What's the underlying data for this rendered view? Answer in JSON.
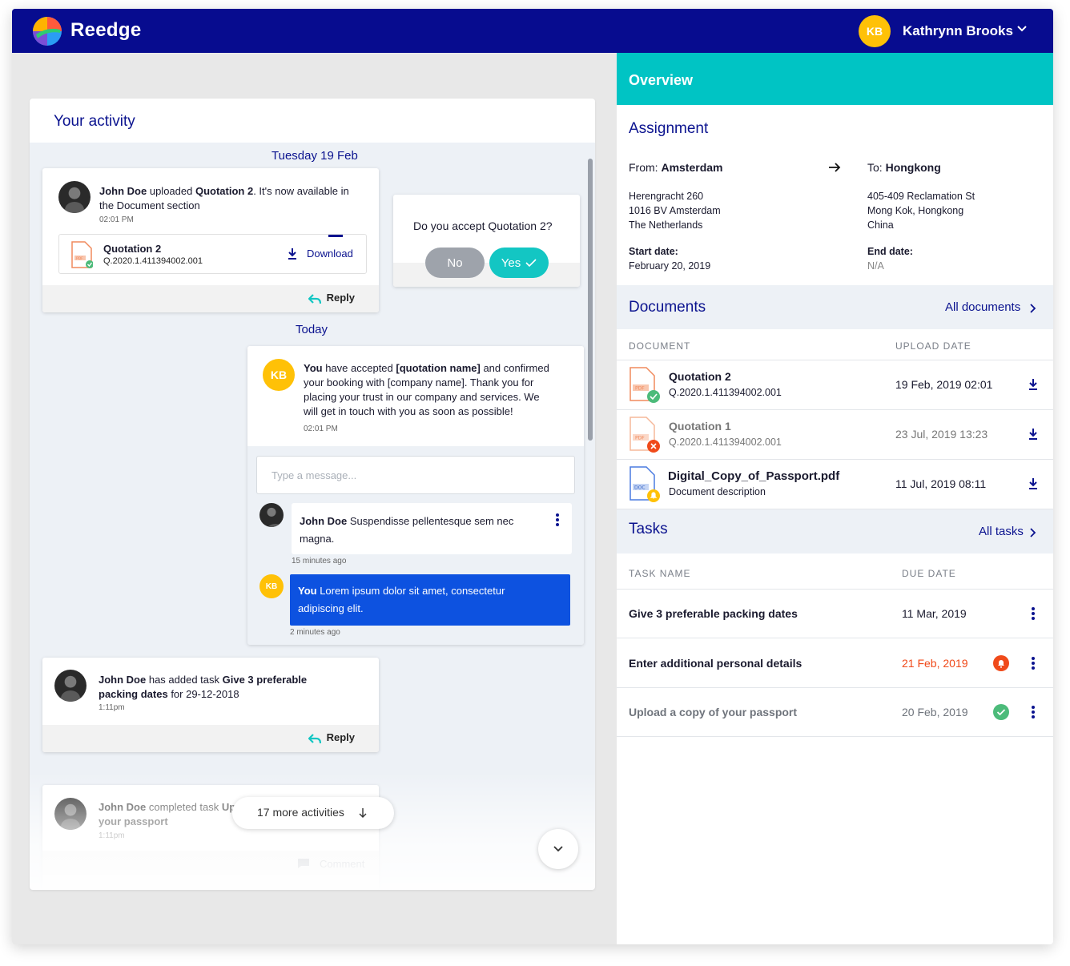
{
  "app": {
    "brand": "Reedge",
    "user_initials": "KB",
    "user_name": "Kathrynn Brooks"
  },
  "activity": {
    "title": "Your activity",
    "date_1": "Tuesday 19 Feb",
    "date_2": "Today",
    "post_1": {
      "actor": "John Doe",
      "text_a": " uploaded ",
      "bold": "Quotation 2",
      "text_b": ". It's now available in",
      "text_c": "the Document section",
      "time": "02:01 PM",
      "doc_name": "Quotation 2",
      "doc_id": "Q.2020.1.411394002.001",
      "download": "Download",
      "reply": "Reply"
    },
    "question": {
      "text": "Do you accept Quotation 2?",
      "no": "No",
      "yes": "Yes"
    },
    "post_2": {
      "actor": "You",
      "line1_a": " have accepted ",
      "line1_b": "[quotation name]",
      "line1_c": " and confirmed",
      "line2": "your booking with [company name]. Thank you for",
      "line3": "placing your trust in our company and services. We",
      "line4": "will get in touch with you as soon as possible!",
      "time": "02:01 PM",
      "placeholder": "Type a message...",
      "comment_1_actor": "John Doe",
      "comment_1_text_a": " Suspendisse pellentesque sem nec",
      "comment_1_text_b": "magna.",
      "comment_1_time": "15 minutes ago",
      "comment_2_actor": "You",
      "comment_2_text_a": " Lorem ipsum dolor sit amet, consectetur",
      "comment_2_text_b": "adipiscing elit.",
      "comment_2_time": "2 minutes ago"
    },
    "post_3": {
      "actor": "John Doe",
      "text_a": " has added task ",
      "bold_a": "Give 3 preferable",
      "bold_b": "packing dates",
      "text_b": "  for 29-12-2018",
      "time": "1:11pm",
      "reply": "Reply"
    },
    "post_4": {
      "actor": "John Doe",
      "text_a": " completed task ",
      "bold_a": "Up",
      "bold_b": "your passport",
      "time": "1:11pm",
      "comment": "Comment"
    },
    "more": "17 more activities"
  },
  "overview": {
    "title": "Overview",
    "assignment": {
      "title": "Assignment",
      "from_label": "From:",
      "from": "Amsterdam",
      "to_label": "To:",
      "to": "Hongkong",
      "from_addr_1": "Herengracht 260",
      "from_addr_2": "1016 BV Amsterdam",
      "from_addr_3": "The Netherlands",
      "to_addr_1": "405-409 Reclamation St",
      "to_addr_2": "Mong Kok, Hongkong",
      "to_addr_3": "China",
      "start_label": "Start date:",
      "start": "February 20, 2019",
      "end_label": "End date:",
      "end": "N/A"
    },
    "documents": {
      "title": "Documents",
      "all_link": "All documents",
      "col_doc": "DOCUMENT",
      "col_date": "UPLOAD DATE",
      "rows": [
        {
          "name": "Quotation 2",
          "sub": "Q.2020.1.411394002.001",
          "date": "19 Feb, 2019 02:01",
          "type": "PDF",
          "status": "approved"
        },
        {
          "name": "Quotation 1",
          "sub": "Q.2020.1.411394002.001",
          "date": "23 Jul, 2019 13:23",
          "type": "PDF",
          "status": "rejected"
        },
        {
          "name": "Digital_Copy_of_Passport.pdf",
          "sub": "Document description",
          "date": "11 Jul, 2019 08:11",
          "type": "DOC",
          "status": "pending"
        }
      ]
    },
    "tasks": {
      "title": "Tasks",
      "all_link": "All tasks",
      "col_name": "TASK NAME",
      "col_date": "DUE DATE",
      "rows": [
        {
          "name": "Give 3 preferable packing dates",
          "date": "11 Mar, 2019",
          "status": "open"
        },
        {
          "name": "Enter additional personal details",
          "date": "21 Feb, 2019",
          "status": "overdue"
        },
        {
          "name": "Upload a copy of your passport",
          "date": "20 Feb, 2019",
          "status": "done"
        }
      ]
    }
  },
  "colors": {
    "navy": "#070c8f",
    "teal": "#00c4c4",
    "accent_yellow": "#ffc107",
    "blue_bubble": "#0d52e0",
    "overdue": "#f04a1a",
    "done": "#4cbb7a"
  },
  "icons": [
    "logo-icon",
    "chevron-down-icon",
    "download-icon",
    "reply-icon",
    "check-icon",
    "arrow-right-icon",
    "chevron-right-icon",
    "kebab-icon",
    "bell-icon",
    "close-icon",
    "arrow-down-icon",
    "comment-icon",
    "pdf-file-icon",
    "doc-file-icon"
  ]
}
